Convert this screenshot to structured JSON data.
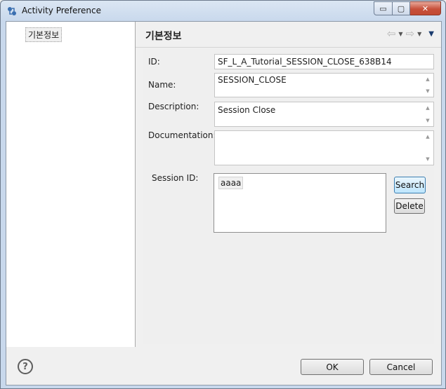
{
  "window": {
    "title": "Activity Preference",
    "minimize_symbol": "▭",
    "maximize_symbol": "▢",
    "close_symbol": "✕"
  },
  "tree": {
    "items": [
      {
        "label": "기본정보"
      }
    ]
  },
  "page": {
    "title": "기본정보",
    "back_symbol": "⇦",
    "forward_symbol": "⇨",
    "dropdown_symbol": "▼",
    "view_menu_symbol": "▼"
  },
  "form": {
    "id_label": "ID:",
    "id_value": "SF_L_A_Tutorial_SESSION_CLOSE_638B14",
    "name_label": "Name:",
    "name_value": "SESSION_CLOSE",
    "description_label": "Description:",
    "description_value": "Session Close",
    "documentation_label": "Documentation:",
    "documentation_value": "",
    "session_id_label": "Session ID:",
    "session_items": [
      "aaaa"
    ],
    "search_label": "Search",
    "delete_label": "Delete"
  },
  "scroll": {
    "up": "▲",
    "down": "▼"
  },
  "footer": {
    "help_symbol": "?",
    "ok_label": "OK",
    "cancel_label": "Cancel"
  },
  "icons": {
    "app": "app-icon",
    "help": "help-icon",
    "back": "back-arrow-icon",
    "forward": "forward-arrow-icon"
  },
  "colors": {
    "title_gradient_top": "#dbe6f3",
    "close_button": "#c7503a",
    "focused_button": "#bee6fd"
  }
}
